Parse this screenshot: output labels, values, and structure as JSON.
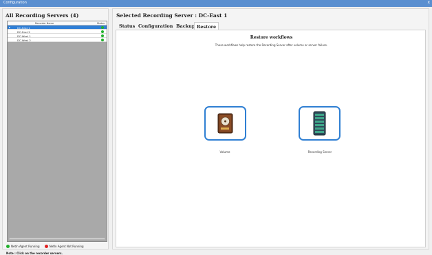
{
  "window": {
    "title": "Configuration",
    "close_glyph": "x"
  },
  "left": {
    "title": "All Recording Servers (4)",
    "columns": {
      "name": "Recorder Name",
      "status": "Status"
    },
    "rows": [
      {
        "name": "DC-East 1",
        "selected": true
      },
      {
        "name": "DC-East 2",
        "selected": false
      },
      {
        "name": "DC-West 1",
        "selected": false
      },
      {
        "name": "DC-West 2",
        "selected": false
      }
    ],
    "legend": {
      "running": "NetIn Agent Running",
      "not_running": "NetIn Agent Not Running"
    },
    "note": "Note : Click on the recorder servers."
  },
  "right": {
    "title": "Selected Recording Server : DC-East 1",
    "tabs": [
      "Status",
      "Configuration",
      "Backup",
      "Restore"
    ],
    "active_tab": "Restore",
    "restore": {
      "heading": "Restore workflows",
      "subheading": "These workflows help restore the Recording Server after volume or server failure.",
      "tiles": [
        {
          "label": "Volume",
          "icon": "hard-disk-icon"
        },
        {
          "label": "Recording Server",
          "icon": "server-icon"
        }
      ]
    }
  },
  "colors": {
    "accent": "#2f7fd3",
    "running": "#1fb02b",
    "not_running": "#e02020",
    "grid_bg": "#a9a9a9",
    "selected_row": "#2e7ed6"
  }
}
